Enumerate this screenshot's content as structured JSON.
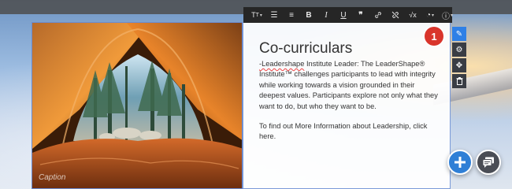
{
  "editor": {
    "heading": "Co-curriculars",
    "paragraph1_lead": "-Leadershape",
    "paragraph1_rest": " Institute Leader: The LeaderShape® Institute™  challenges participants to lead with integrity while working towards a vision grounded in their deepest values. Participants explore not only what they want to do, but who they want to be.",
    "paragraph2": "To find out More Information about Leadership, click here."
  },
  "image": {
    "caption": "Caption"
  },
  "toolbar": {
    "font_size_label": "Tт",
    "buttons": [
      "format-size-icon",
      "bullet-list-icon",
      "numbered-list-icon",
      "bold-icon",
      "italic-icon",
      "underline-icon",
      "quote-icon",
      "link-icon",
      "unlink-icon",
      "formula-icon",
      "color-icon",
      "info-icon"
    ]
  },
  "side_tools": [
    "edit-icon",
    "settings-icon",
    "move-icon",
    "delete-icon"
  ],
  "step_badge": "1",
  "colors": {
    "accent": "#2f80e6",
    "badge": "#d9342b",
    "toolbar": "#262626"
  }
}
